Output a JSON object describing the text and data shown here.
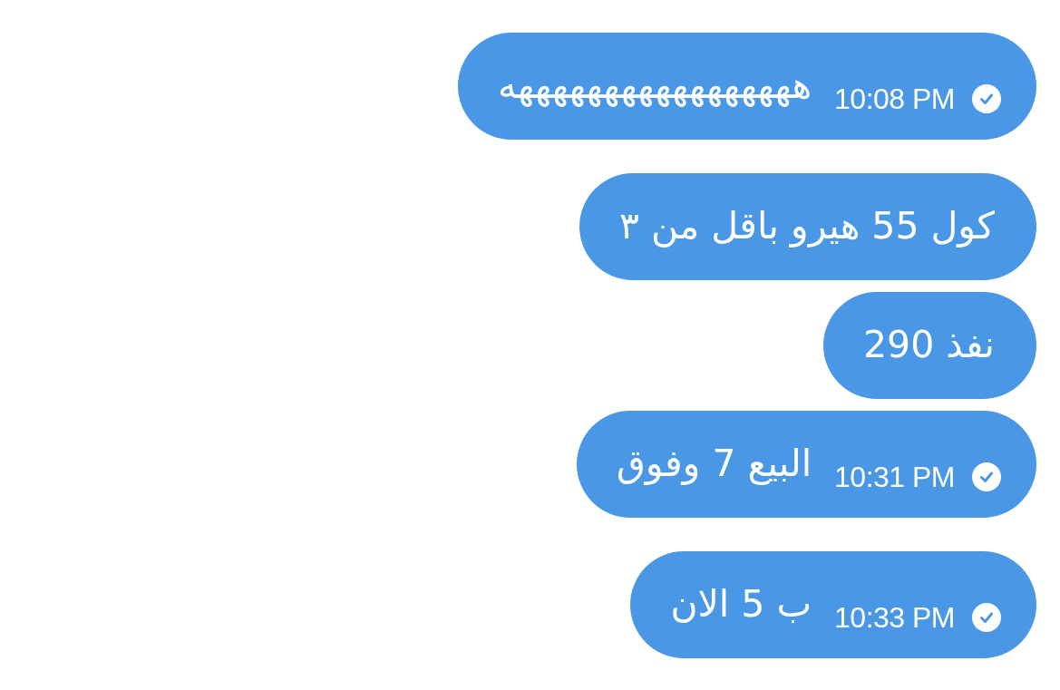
{
  "messages": [
    {
      "text": "هههههههههههههههههه",
      "time": "10:08 PM",
      "read": true
    },
    {
      "text": "كول 55 هيرو باقل من ٣"
    },
    {
      "text": "نفذ 290"
    },
    {
      "text": "البيع 7 وفوق",
      "time": "10:31 PM",
      "read": true
    },
    {
      "text": "ب 5 الان",
      "time": "10:33 PM",
      "read": true
    }
  ]
}
